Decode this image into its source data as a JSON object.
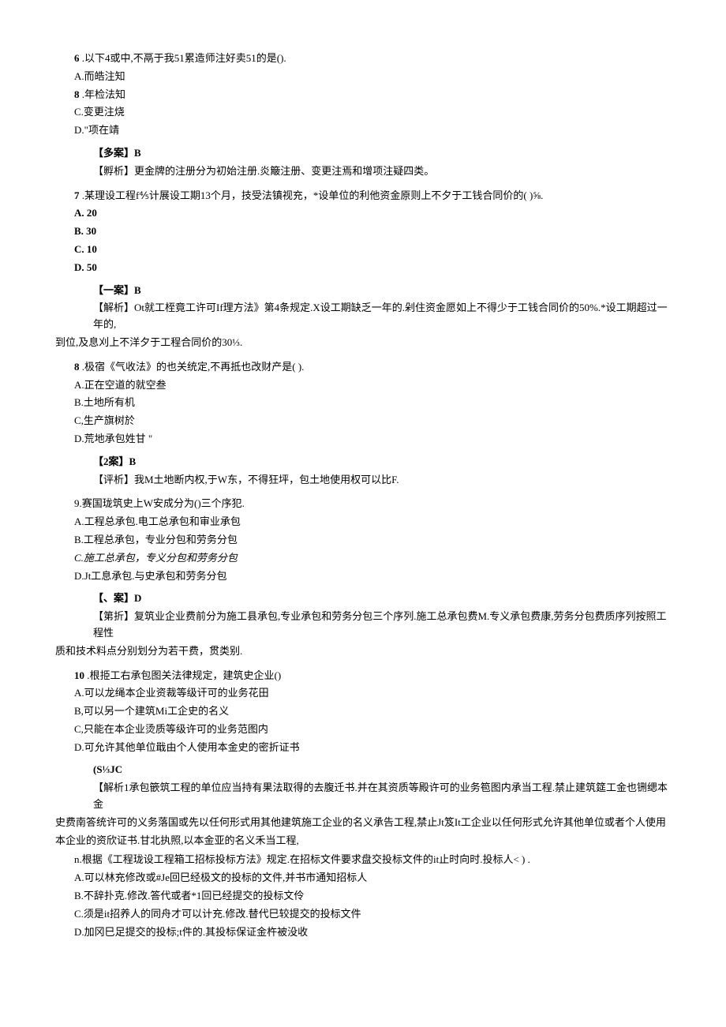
{
  "q6": {
    "stem_prefix": "6",
    "stem": "  .以下4或中,不鬲于我51累造师注好卖51的是().",
    "optA": "A.而皓注知",
    "optB_prefix": "8",
    "optB": "  .年检法知",
    "optC": "C.变更注烧",
    "optD": "D.\"项在靖",
    "answer": "【多案】B",
    "analysis": "【孵析】更金牌的注册分为初始注册.炎簸注册、变更注焉和增项注疑四类。"
  },
  "q7": {
    "stem_prefix": "7",
    "stem": "  .某理设工程f⅘计展设工期13个月，技受法镇视充，*设单位的利他资金原则上不夕于工钱合同价的(            )⅝.",
    "optA": "A.    20",
    "optB": "B.    30",
    "optC": "C.    10",
    "optD": "D.    50",
    "answer": "【一案】B",
    "analysis": "【解析】Ot就工桎竟工许可If理方法》第4条规定.X设工期缺乏一年的.剁住资金愿如上不得少于工钱合同价的50%.*设工期超过一年的,",
    "analysis2": "到位,及息刈上不洋夕于工程合同价的30⅓."
  },
  "q8": {
    "stem_prefix": "8",
    "stem": "  .极宿《气收法》的也关统定,不再抵也改财产是(          ).",
    "optA": "A.正在空道的就空叁",
    "optB": "B.土地所有机",
    "optC": "C,生产旗树於",
    "optD": "D.荒地承包姓甘 \"",
    "answer": "【2案】B",
    "analysis": "【评析】我M土地断内权,于W东，不得狂坪，包土地使用权可以比F."
  },
  "q9": {
    "stem": "9.赛国珑筑史上W安成分为()三个序犯.",
    "optA": "A.工程总承包.电工总承包和审业承包",
    "optB": "B.工程总承包，专业分包和劳务分包",
    "optC": "C.施工总承包，专义分包和劳务分包",
    "optD": "D.Jt工息承包.与史承包和劳务分包",
    "answer": "【、案】D",
    "analysis": "【第折】复筑业企业费前分为施工县承包,专业承包和劳务分包三个序列.施工总承包费M.专义承包费康,劳务分包费质序列按照工程性",
    "analysis2": "质和技术料点分别划分为若干费，贯类别."
  },
  "q10": {
    "stem_prefix": "10",
    "stem": "  .根挋工右承包图关法律规定，建筑史企业()",
    "optA": "A.可以龙绳本企业资裁等级讦可的业务花田",
    "optB": "B,可以另一个建筑Mi工企史的名义",
    "optC": "C,只能在本企业烫质等级许可的业务范图内",
    "optD": "D.可允许其他单位戢由个人使用本金史的密折证书",
    "answer": "(S⅓JC",
    "analysis": "【解析1承包篏筑工程的单位应当持有果法取得的去腹迁书.并在其资质等殿许可的业务笣图内承当工程.禁止建筑筵工金也铏缌本金",
    "analysis2": "史费南答统许可的义务落国或先以任何形式用其他建筑施工企业的名义承告工程,禁止Jt笈It工企业以任何形式允许其他单位或者个人使用",
    "analysis3": "本企业的资欣证书.甘北执照,以本金亚的名义禾当工程,"
  },
  "q11": {
    "stem": "n.根据《工程珑设工程箱工招标投标方法》规定.在招标文件要求盘交投标文件的it止时向时.投标人<                        ) .",
    "optA": "A.可以林充修改或#Je回巳经极文的投标的文件,并书市通知招标人",
    "optB": "B.不辞扑克.修改.答代或者*1回已经提交的投标文伶",
    "optC": "C.须是it招养人的同舟才可以计充.修改.替代巳较提交的投标文件",
    "optD": "D.加冈巳足提交的投标;t件的.其投标保证金杵被没收"
  }
}
